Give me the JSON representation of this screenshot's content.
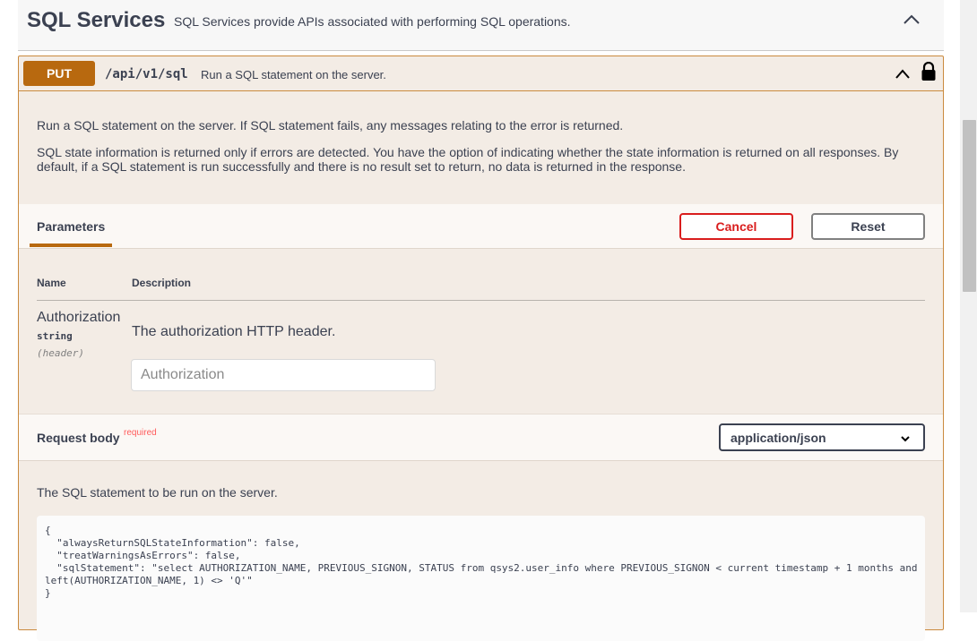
{
  "section": {
    "title": "SQL Services",
    "description": "SQL Services provide APIs associated with performing SQL operations."
  },
  "operation": {
    "method": "PUT",
    "path": "/api/v1/sql",
    "summary": "Run a SQL statement on the server.",
    "description_1": "Run a SQL statement on the server. If SQL statement fails, any messages relating to the error is returned.",
    "description_2": "SQL state information is returned only if errors are detected. You have the option of indicating whether the state information is returned on all responses. By default, if a SQL statement is run successfully and there is no result set to return, no data is returned in the response."
  },
  "parameters": {
    "tab_label": "Parameters",
    "cancel_label": "Cancel",
    "reset_label": "Reset",
    "col_name": "Name",
    "col_description": "Description",
    "items": [
      {
        "name": "Authorization",
        "type": "string",
        "in": "(header)",
        "description": "The authorization HTTP header.",
        "placeholder": "Authorization",
        "value": ""
      }
    ]
  },
  "request_body": {
    "title": "Request body",
    "required_label": "required",
    "content_type": "application/json",
    "description": "The SQL statement to be run on the server.",
    "example": "{\n  \"alwaysReturnSQLStateInformation\": false,\n  \"treatWarningsAsErrors\": false,\n  \"sqlStatement\": \"select AUTHORIZATION_NAME, PREVIOUS_SIGNON, STATUS from qsys2.user_info where PREVIOUS_SIGNON < current timestamp + 1 months and\nleft(AUTHORIZATION_NAME, 1) <> 'Q'\"\n}"
  },
  "colors": {
    "put_method": "#b8690f",
    "opblock_bg": "#f3ece5",
    "opblock_border": "#ca8a3e",
    "cancel": "#d91d1d",
    "required": "#ff5b5b"
  },
  "icons": {
    "section_collapse": "chevron-up-icon",
    "op_collapse": "chevron-up-icon",
    "lock": "lock-icon",
    "select_dropdown": "chevron-down-icon"
  }
}
